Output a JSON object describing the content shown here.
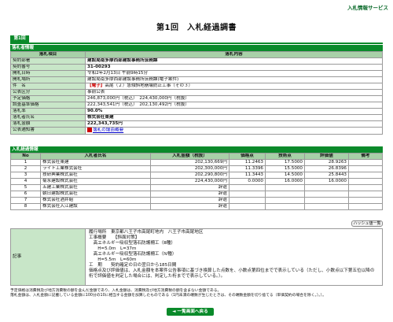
{
  "header": {
    "service_link": "入札情報サービス",
    "title": "第1回　入札経過調書",
    "round_tab": "第1回"
  },
  "info": {
    "section_title": "落札者情報",
    "col_item": "落札項目",
    "col_content": "落札内容",
    "rows": [
      {
        "label": "契約部署",
        "value": "建設局南多摩西部建設事務所庶務課",
        "bold": true
      },
      {
        "label": "契約番号",
        "value": "31-00293",
        "bold": true
      },
      {
        "label": "開札日時",
        "value": "令和2年2月13日 午前9時15分"
      },
      {
        "label": "開札場所",
        "value": "建設局南多摩西部建設事務所庶務課(電子案件)"
      },
      {
        "label": "件　名",
        "prefix": "【電子】",
        "value": "高尾（２）急傾斜地崩壊防止工事（その３）"
      },
      {
        "label": "公表区分",
        "value": "事前公表"
      },
      {
        "label": "予定価格",
        "value": "246,873,000円（税込）　224,430,000円（税抜）"
      },
      {
        "label": "調査基準価格",
        "value": "222,343,541円（税込）　202,130,492円（税抜）"
      },
      {
        "label": "落札率",
        "value": "90.0%",
        "bold": true
      },
      {
        "label": "落札者氏名",
        "value": "株式会社東建",
        "bold": true
      },
      {
        "label": "落札金額",
        "value": "222,343,735円",
        "bold": true
      },
      {
        "label": "公表通知書",
        "value": "落札の理由概要",
        "link": true
      }
    ]
  },
  "bids": {
    "section_title": "入札経過情報",
    "headers": [
      "No",
      "入札者氏名",
      "入札金額（税抜）",
      "価格点",
      "技術点",
      "評価値",
      "備考"
    ],
    "rows": [
      {
        "no": "1",
        "name": "株式会社東建",
        "amount": "202,130,669円",
        "price": "11.2463",
        "tech": "17.5000",
        "eval": "28.9263",
        "note": ""
      },
      {
        "no": "2",
        "name": "ライト工業株式会社",
        "amount": "202,300,000円",
        "price": "11.3396",
        "tech": "15.5000",
        "eval": "26.8396",
        "note": ""
      },
      {
        "no": "3",
        "name": "技研興業株式会社",
        "amount": "202,290,800円",
        "price": "11.3443",
        "tech": "14.5000",
        "eval": "25.8443",
        "note": ""
      },
      {
        "no": "4",
        "name": "菊永建設株式会社",
        "amount": "224,430,000円",
        "price": "0.0000",
        "tech": "16.0000",
        "eval": "16.0000",
        "note": ""
      },
      {
        "no": "5",
        "name": "五建工業株式会社",
        "amount": "辞退",
        "price": "",
        "tech": "",
        "eval": "",
        "note": ""
      },
      {
        "no": "6",
        "name": "朝日建設株式会社",
        "amount": "辞退",
        "price": "",
        "tech": "",
        "eval": "",
        "note": ""
      },
      {
        "no": "7",
        "name": "株式会社酒井組",
        "amount": "辞退",
        "price": "",
        "tech": "",
        "eval": "",
        "note": ""
      },
      {
        "no": "8",
        "name": "株式会社入江建設",
        "amount": "辞退",
        "price": "",
        "tech": "",
        "eval": "",
        "note": ""
      }
    ],
    "hash_button": "ハッシュ値一覧"
  },
  "remarks": {
    "label": "記事",
    "text": "履行場所　東京都八王子市高尾町地内　八王子市高尾地区\n工事概要　　【斜面対策】\n　高エネルギー吸収型落石防護柵工（Ⅲ種）\n　　H=5.0m　L=37m\n　高エネルギー吸収型落石防護柵工（Ⅳ種）\n　　H=5.5m　L=60m\n工　期　　契約確定の日の翌日から185日間\n価格点及び評価値は、入札金額を本案件公告事項に基づき換算した点数を、小数点第四位までで表示している（ただし、小数点以下第五位以降の桁で評価値を判定した場合には、判定した桁までで表示している。）。"
  },
  "notes": [
    "予定価格は消費税及び地方消費税の額を含んだ金額であり、入札金額は、消費税及び地方消費税の額を含まない金額である。",
    "落札金額は、入札金額に記載している金額に100分の10に相当する金額を加算したものである（1円未満の端数が生じたときは、その端数金額を切り捨てる（単価契約の場合を除く。）。）。"
  ],
  "back_button": "◄ 一覧画面へ戻る"
}
